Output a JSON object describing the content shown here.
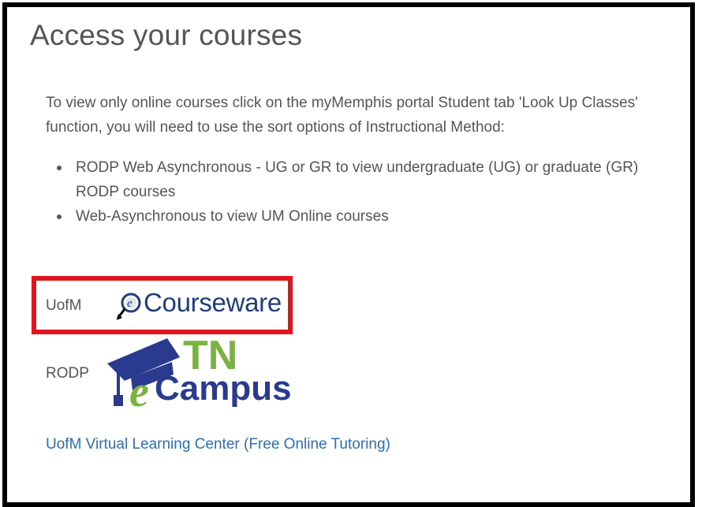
{
  "page": {
    "title": "Access your courses",
    "intro": "To view only online courses click on the myMemphis portal Student tab 'Look Up Classes' function, you will need to use the sort options of Instructional Method:",
    "bullets": [
      "RODP Web Asynchronous - UG or GR to view undergraduate (UG) or graduate (GR) RODP courses",
      "Web-Asynchronous to view UM Online courses"
    ]
  },
  "platforms": {
    "uofm": {
      "label": "UofM",
      "logo_text": "Courseware",
      "logo_icon": "magnifier-e-icon",
      "highlight_color": "#e0161f"
    },
    "rodp": {
      "label": "RODP",
      "logo_top": "TN",
      "logo_e": "e",
      "logo_bottom": "Campus",
      "logo_icon": "graduation-cap-icon",
      "colors": {
        "green": "#7ab342",
        "blue": "#2a3b8f"
      }
    }
  },
  "links": {
    "vlc": "UofM Virtual Learning Center (Free Online Tutoring)"
  }
}
